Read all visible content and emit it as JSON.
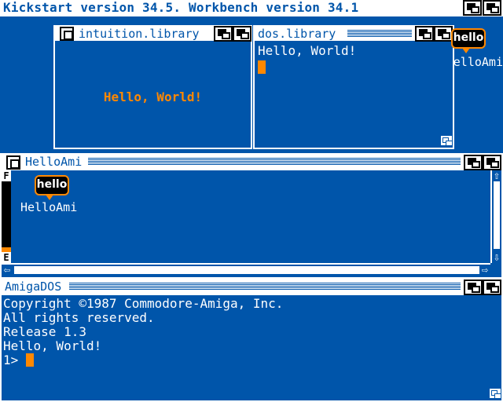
{
  "screen": {
    "title": "Kickstart version 34.5. Workbench version 34.1"
  },
  "intuition_window": {
    "title": "intuition.library",
    "message": "Hello, World!"
  },
  "dos_window": {
    "title": "dos.library",
    "message": "Hello, World!"
  },
  "desktop_icon": {
    "bubble_text": "hello",
    "label": "HelloAmi"
  },
  "helloami_window": {
    "title": "HelloAmi",
    "icon_bubble_text": "hello",
    "icon_label": "HelloAmi",
    "gauge_top": "F",
    "gauge_bottom": "E"
  },
  "amigados_window": {
    "title": "AmigaDOS",
    "lines": [
      "Copyright ©1987 Commodore-Amiga, Inc.",
      "All rights reserved.",
      "Release 1.3",
      "Hello, World!"
    ],
    "prompt": "1> "
  },
  "colors": {
    "background": "#0055aa",
    "text": "#ffffff",
    "accent": "#ff8800",
    "shadow": "#000000"
  }
}
